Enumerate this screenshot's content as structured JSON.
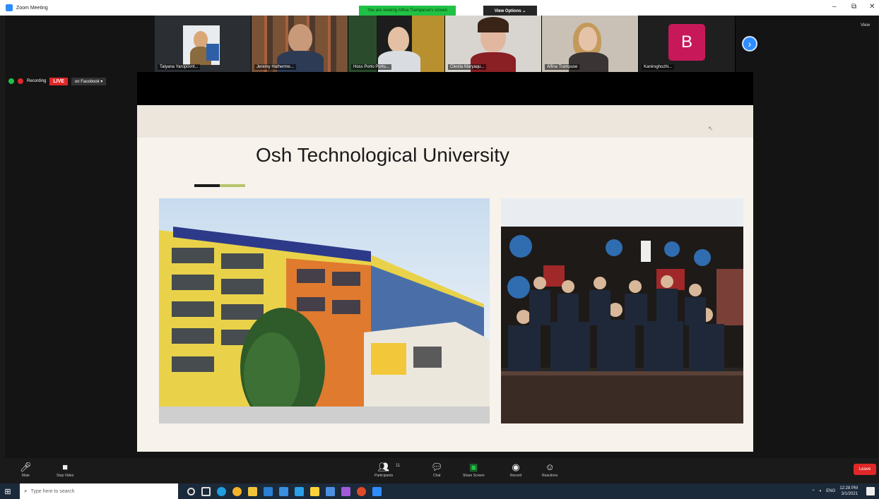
{
  "window": {
    "title": "Zoom Meeting",
    "minimize_glyph": "–",
    "maximize_glyph": "⧉",
    "close_glyph": "✕"
  },
  "share_banner": {
    "text": "You are viewing Alfina Tramparue's screen",
    "view_options": "View Options ⌄"
  },
  "participants": [
    {
      "name": "Tatyana Yaropovnt..."
    },
    {
      "name": "Jeremy Hatherme..."
    },
    {
      "name": "Hoss Porto Portu..."
    },
    {
      "name": "Clestia Maryaqu..."
    },
    {
      "name": "Alfina Trampuse"
    },
    {
      "name": "Kaniroghozhi..."
    }
  ],
  "avatar_letter": "B",
  "next_page_glyph": "›",
  "view_label": "View",
  "recording": {
    "label": "Recording",
    "live": "LIVE",
    "platform": "on Facebook ▾"
  },
  "slide": {
    "title": "Osh Technological University",
    "cursor_glyph": "↖"
  },
  "controls": {
    "mute": {
      "label": "Mute",
      "icon": "mic-icon"
    },
    "stop_video": {
      "label": "Stop Video",
      "icon": "video-icon"
    },
    "participants": {
      "label": "Participants",
      "count": "11",
      "icon": "participants-icon"
    },
    "chat": {
      "label": "Chat",
      "icon": "chat-icon"
    },
    "share_screen": {
      "label": "Share Screen",
      "icon": "share-screen-icon"
    },
    "record": {
      "label": "Record",
      "icon": "record-icon"
    },
    "reactions": {
      "label": "Reactions",
      "icon": "reactions-icon"
    },
    "leave": {
      "label": "Leave"
    }
  },
  "taskbar": {
    "search_placeholder": "Type here to search",
    "time": "12:28 PM",
    "date": "3/1/2021",
    "lang": "ENG"
  },
  "colors": {
    "zoom_blue": "#2d8cff",
    "share_green": "#20c145",
    "live_red": "#e02828",
    "avatar_pink": "#c7195a"
  }
}
